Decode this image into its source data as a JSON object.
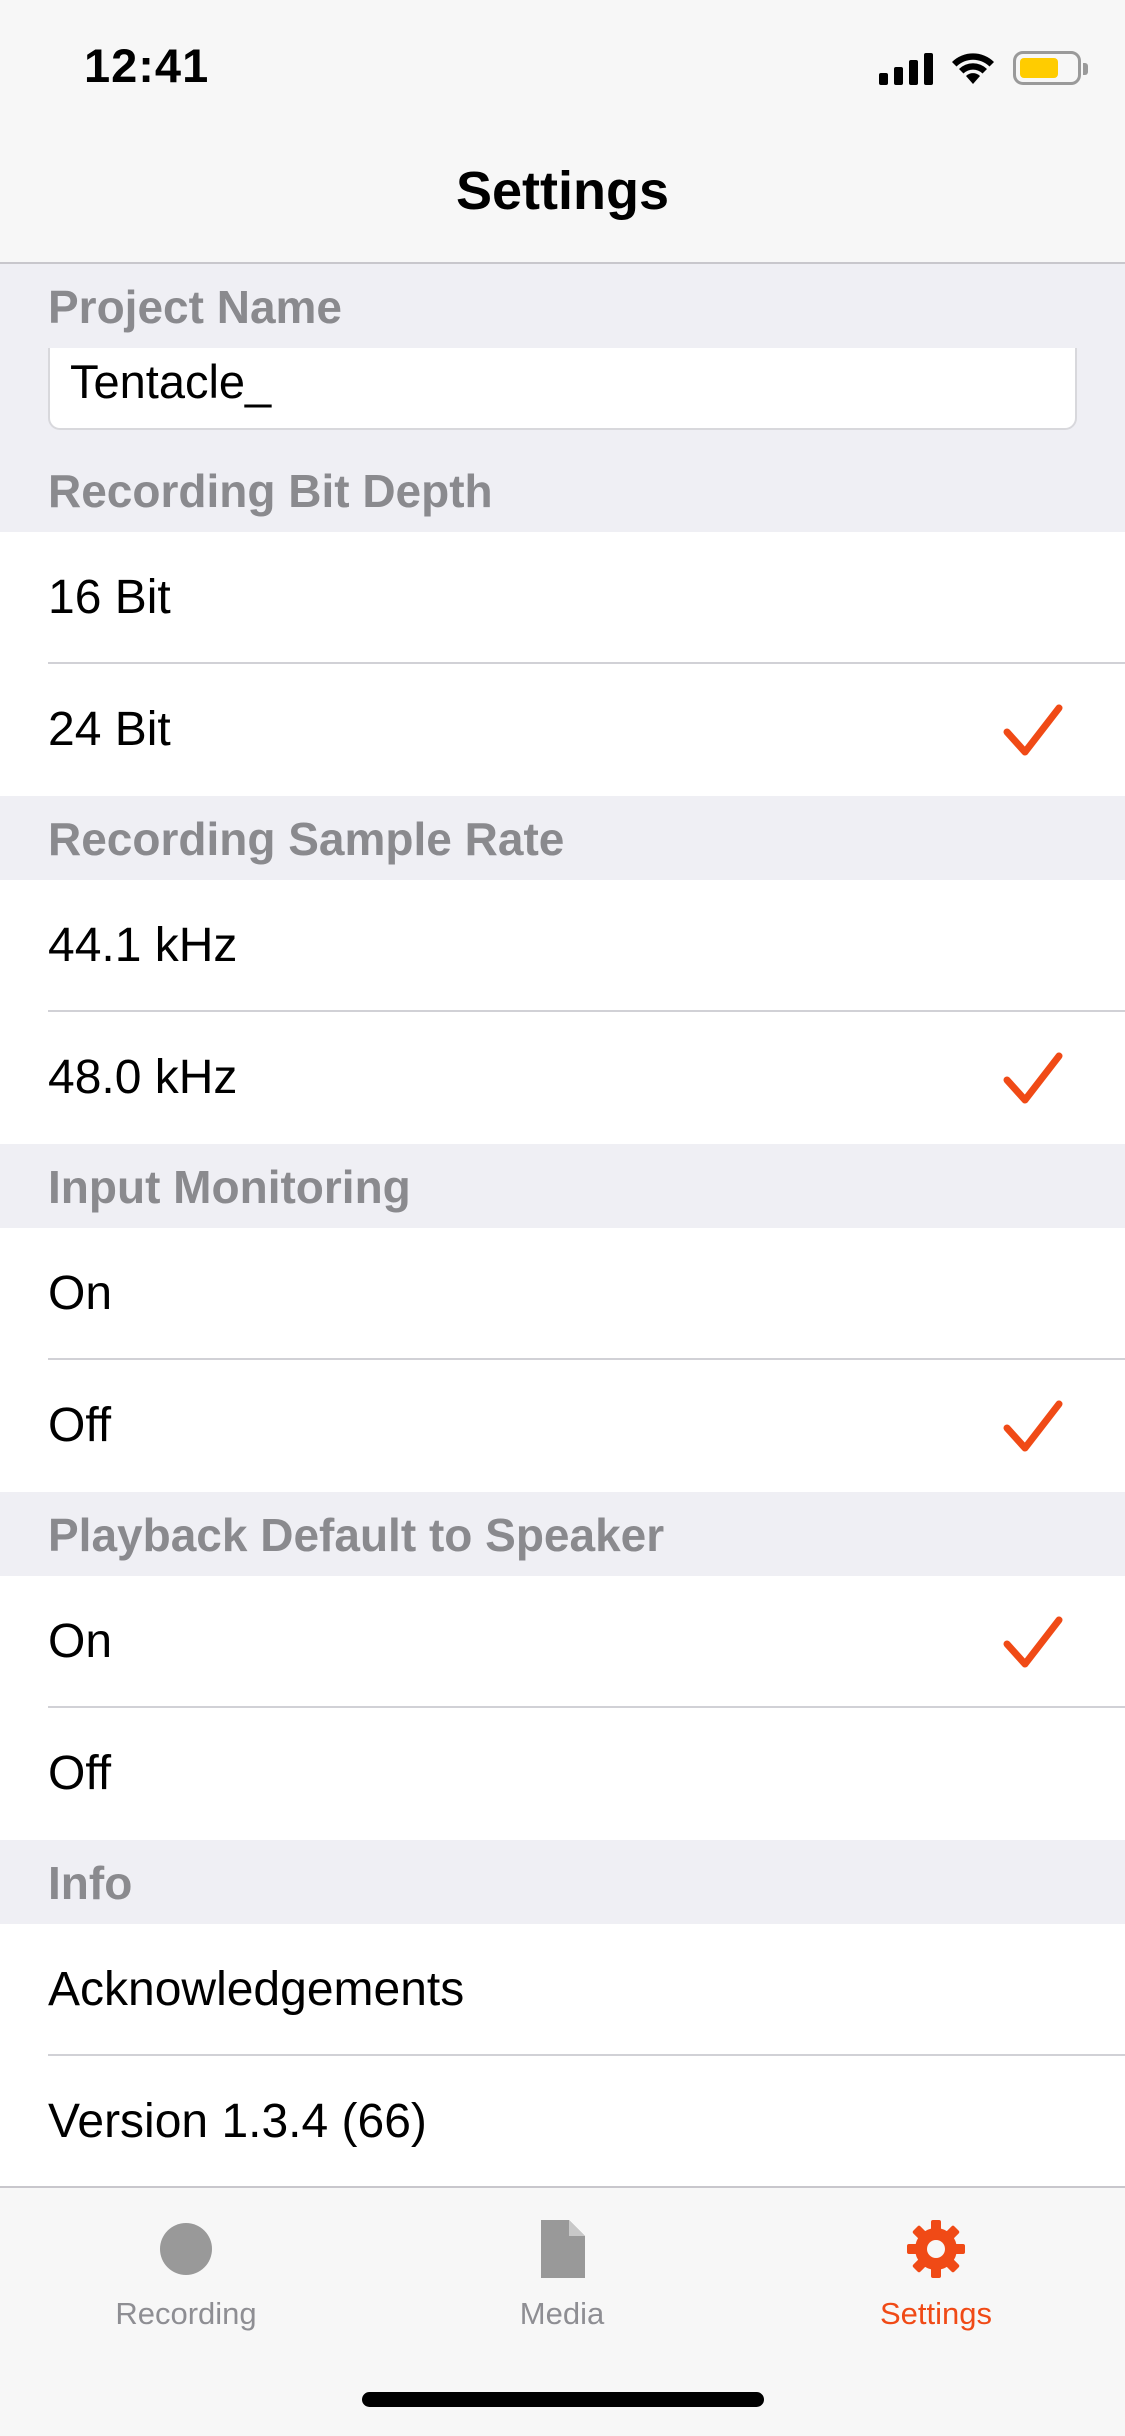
{
  "status_bar": {
    "time": "12:41",
    "battery_color": "#ffcc00"
  },
  "nav": {
    "title": "Settings"
  },
  "accent_color": "#f04a16",
  "sections": {
    "project_name": {
      "header": "Project Name",
      "value": "Tentacle_"
    },
    "bit_depth": {
      "header": "Recording Bit Depth",
      "options": [
        {
          "label": "16 Bit",
          "selected": false
        },
        {
          "label": "24 Bit",
          "selected": true
        }
      ]
    },
    "sample_rate": {
      "header": "Recording Sample Rate",
      "options": [
        {
          "label": "44.1 kHz",
          "selected": false
        },
        {
          "label": "48.0 kHz",
          "selected": true
        }
      ]
    },
    "input_monitoring": {
      "header": "Input Monitoring",
      "options": [
        {
          "label": "On",
          "selected": false
        },
        {
          "label": "Off",
          "selected": true
        }
      ]
    },
    "playback_speaker": {
      "header": "Playback Default to Speaker",
      "options": [
        {
          "label": "On",
          "selected": true
        },
        {
          "label": "Off",
          "selected": false
        }
      ]
    },
    "info": {
      "header": "Info",
      "items": [
        {
          "label": "Acknowledgements"
        },
        {
          "label": "Version 1.3.4 (66)"
        }
      ]
    }
  },
  "tabbar": {
    "tabs": [
      {
        "label": "Recording",
        "icon": "record-circle-icon",
        "active": false
      },
      {
        "label": "Media",
        "icon": "document-icon",
        "active": false
      },
      {
        "label": "Settings",
        "icon": "gear-icon",
        "active": true
      }
    ]
  }
}
